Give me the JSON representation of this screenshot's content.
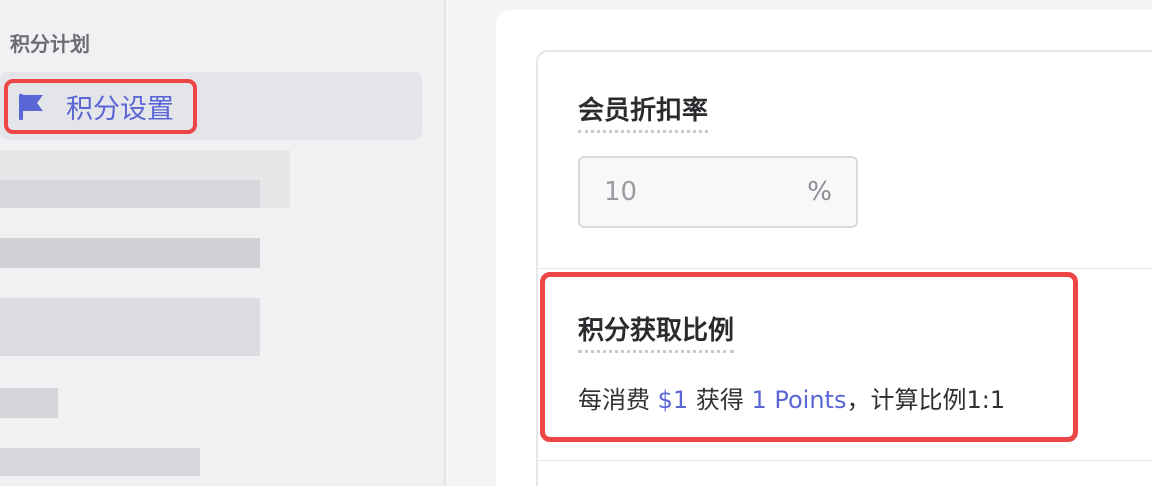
{
  "sidebar": {
    "section_title": "积分计划",
    "active_item": {
      "label": "积分设置",
      "icon": "flag-icon"
    }
  },
  "colors": {
    "accent": "#5b66d6",
    "highlight": "#ec4646"
  },
  "main": {
    "discount": {
      "label": "会员折扣率",
      "value": "10",
      "suffix": "%"
    },
    "ratio": {
      "label": "积分获取比例",
      "prefix": "每消费",
      "amount": "$1",
      "middle": "获得",
      "points": "1 Points",
      "suffix": "，计算比例1:1"
    }
  }
}
